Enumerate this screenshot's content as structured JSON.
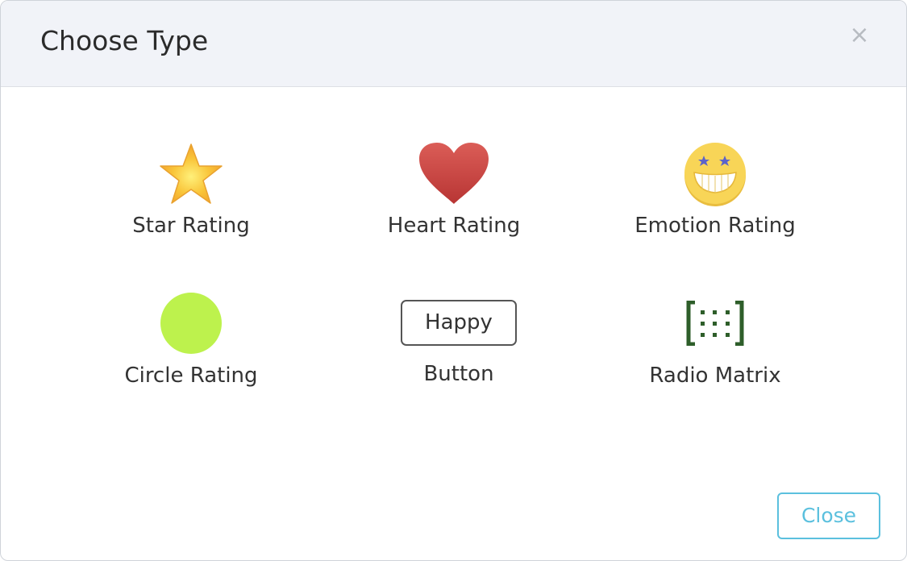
{
  "dialog": {
    "title": "Choose Type",
    "close_glyph": "×",
    "close_label": "Close"
  },
  "options": [
    {
      "label": "Star Rating",
      "icon": "star-icon",
      "color": "#f5b83a"
    },
    {
      "label": "Heart Rating",
      "icon": "heart-icon",
      "color": "#d04e4b"
    },
    {
      "label": "Emotion Rating",
      "icon": "emoji-star-eyes-icon",
      "color": "#f4cf4f"
    },
    {
      "label": "Circle Rating",
      "icon": "circle-icon",
      "color": "#bdf24d"
    },
    {
      "label": "Button",
      "icon": "button-preview",
      "button_text": "Happy"
    },
    {
      "label": "Radio Matrix",
      "icon": "radio-matrix-icon",
      "color": "#2e5e2a"
    }
  ],
  "colors": {
    "accent": "#5bc0de",
    "header_bg": "#f1f3f8"
  }
}
